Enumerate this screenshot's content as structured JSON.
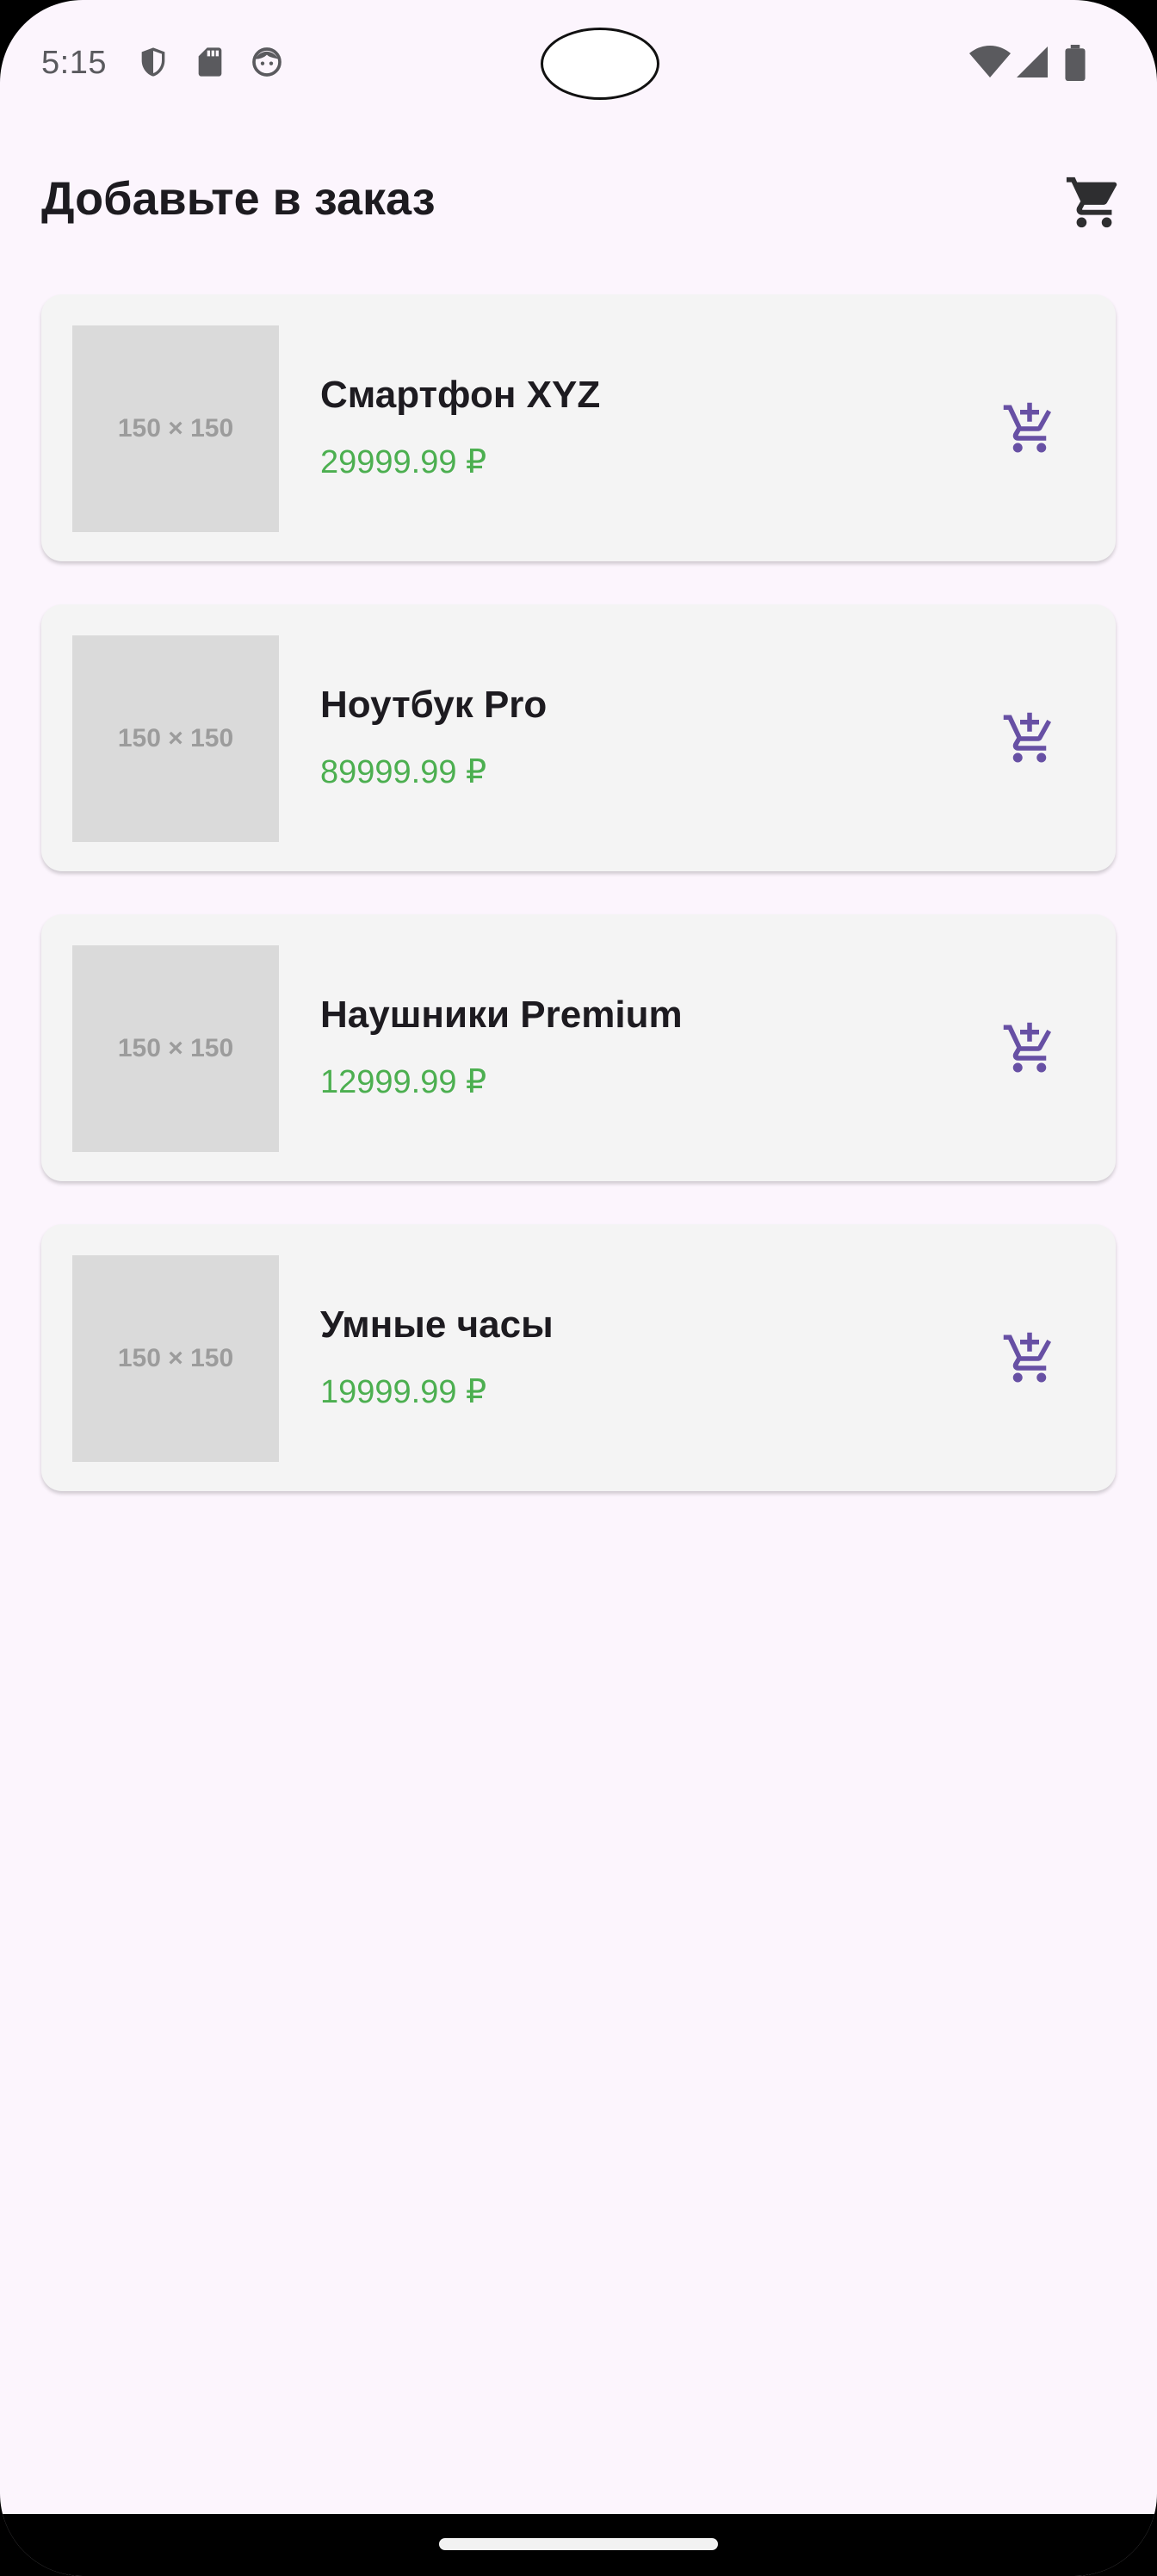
{
  "status_bar": {
    "time": "5:15",
    "left_icons": [
      "shield-icon",
      "sd-card-icon",
      "face-icon"
    ],
    "right_icons": [
      "wifi-icon",
      "signal-icon",
      "battery-icon"
    ]
  },
  "header": {
    "title": "Добавьте в заказ",
    "cart_icon": "shopping-cart-icon"
  },
  "products": [
    {
      "name": "Смартфон XYZ",
      "price": "29999.99 ₽",
      "image_placeholder": "150 × 150"
    },
    {
      "name": "Ноутбук Pro",
      "price": "89999.99 ₽",
      "image_placeholder": "150 × 150"
    },
    {
      "name": "Наушники Premium",
      "price": "12999.99 ₽",
      "image_placeholder": "150 × 150"
    },
    {
      "name": "Умные часы",
      "price": "19999.99 ₽",
      "image_placeholder": "150 × 150"
    }
  ],
  "colors": {
    "background": "#fcf5fd",
    "card": "#f4f4f4",
    "price": "#4caf50",
    "accent": "#6750a4",
    "text": "#1d1b20"
  }
}
